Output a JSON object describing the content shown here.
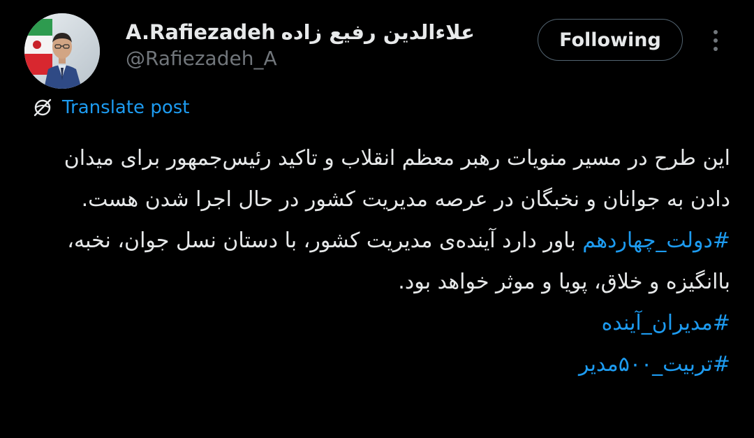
{
  "author": {
    "display_name_latin": "A.Rafiezadeh",
    "display_name_persian": "علاءالدین رفیع زاده",
    "handle": "@Rafiezadeh_A"
  },
  "actions": {
    "follow_label": "Following"
  },
  "translate": {
    "label": "Translate post"
  },
  "post": {
    "paragraph_1": "این طرح در مسیر منویات رهبر معظم انقلاب و تاکید رئیس‌جمهور برای میدان دادن به جوانان و نخبگان در عرصه مدیریت کشور در حال اجرا شدن هست.",
    "hashtag_1": "#دولت_چهاردهم",
    "paragraph_2": " باور دارد آینده‌ی مدیریت کشور، با دستان نسل جوان، نخبه، باانگیزه و خلاق، پویا و موثر خواهد بود.",
    "hashtag_2": "#مدیران_آینده",
    "hashtag_3": "#تربیت_۵۰۰مدیر"
  },
  "icons": {
    "avatar": "profile-photo",
    "more": "more-icon",
    "translate": "translate-globe-icon"
  },
  "colors": {
    "background": "#000000",
    "text": "#e7e9ea",
    "muted": "#71767b",
    "link": "#1d9bf0",
    "button_border": "#536471"
  }
}
